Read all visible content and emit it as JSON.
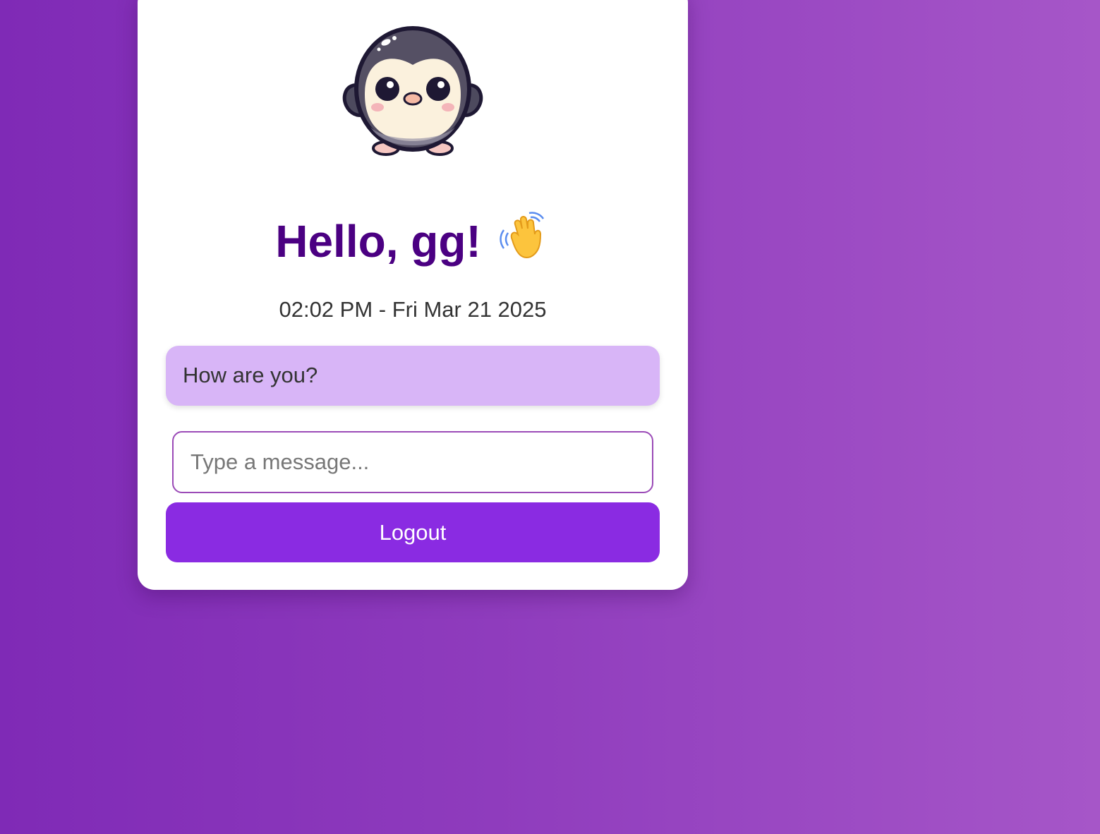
{
  "greeting": {
    "text": "Hello, gg!"
  },
  "icons": {
    "avatar": "penguin-avatar",
    "wave": "waving-hand-icon"
  },
  "datetime": "02:02 PM - Fri Mar 21 2025",
  "message": {
    "text": "How are you?"
  },
  "input": {
    "value": "",
    "placeholder": "Type a message..."
  },
  "logout": {
    "label": "Logout"
  },
  "colors": {
    "background_start": "#7f2ab6",
    "background_end": "#a656c8",
    "greeting": "#4b0082",
    "message_bubble": "#d8b5f7",
    "button": "#8a2be2",
    "input_border": "#9b4bb7"
  }
}
